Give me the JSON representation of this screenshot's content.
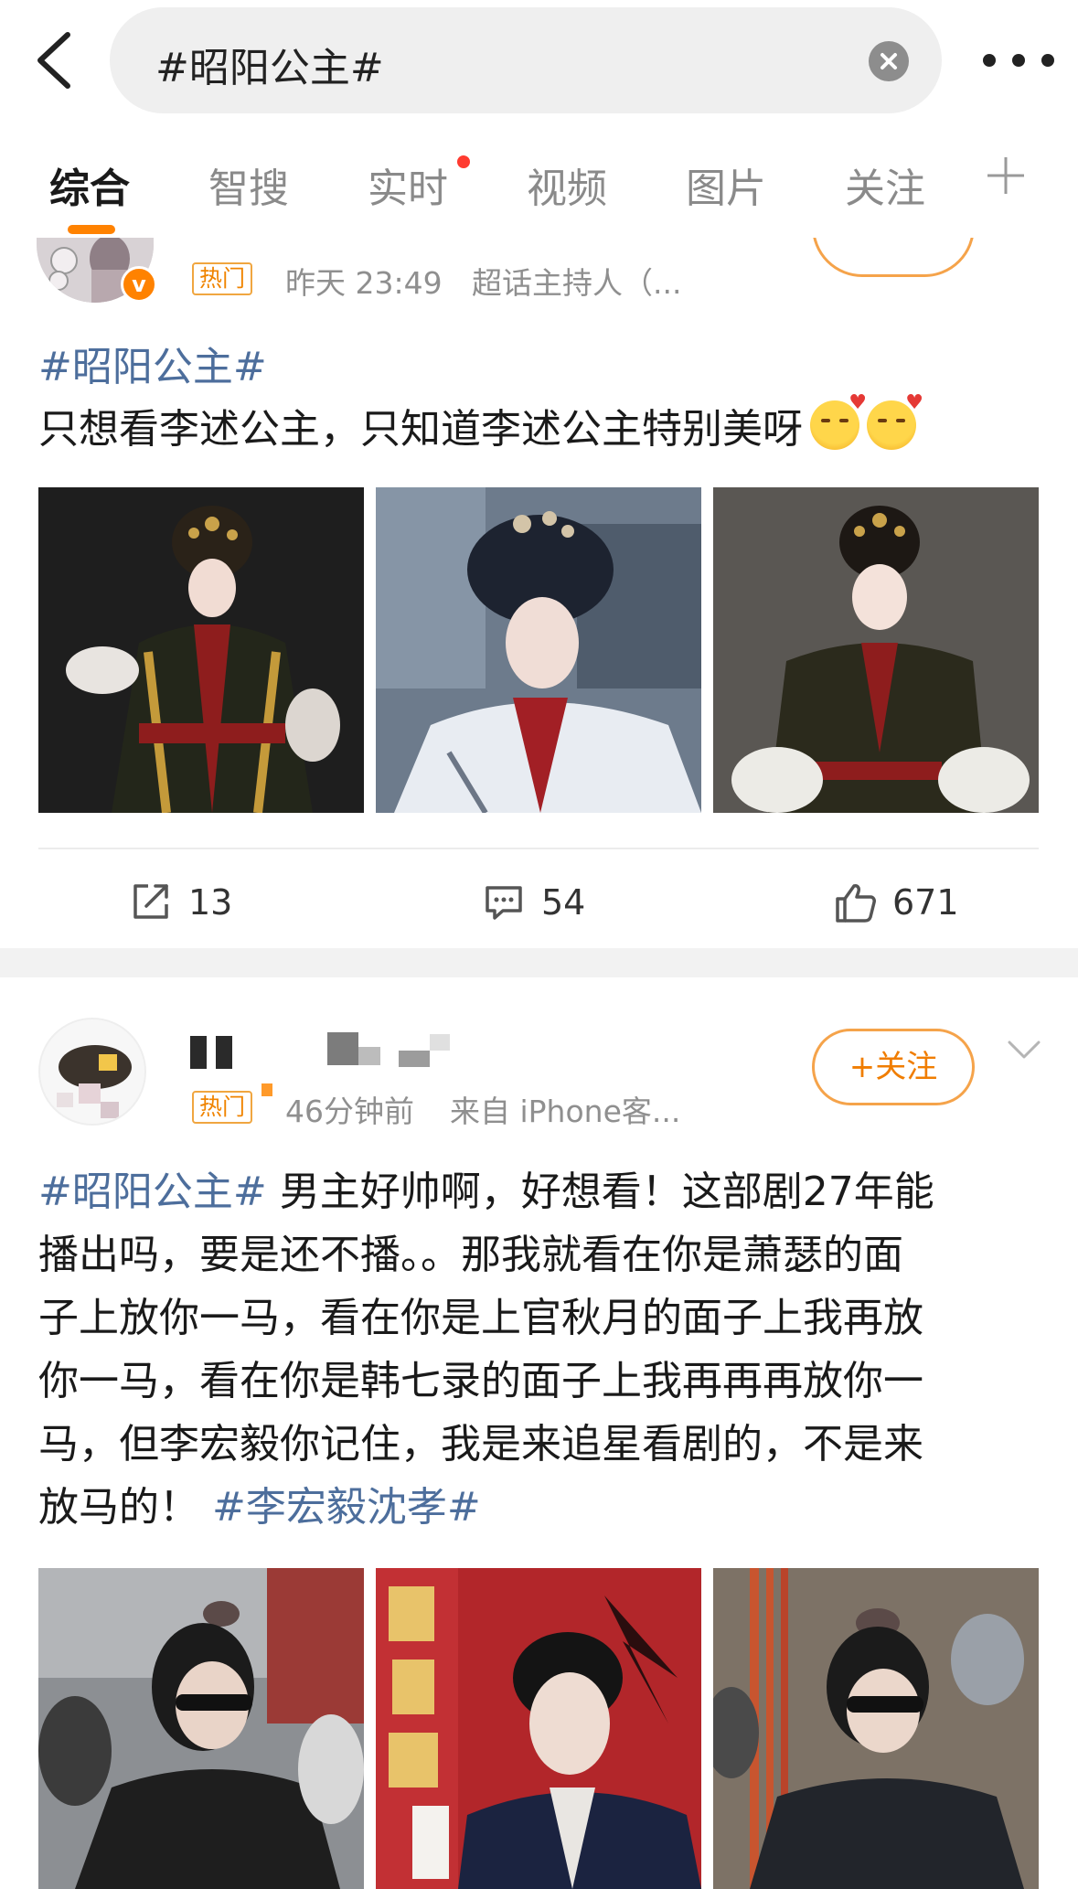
{
  "search": {
    "query": "#昭阳公主#"
  },
  "tabs": [
    {
      "label": "综合",
      "active": true
    },
    {
      "label": "智搜",
      "active": false
    },
    {
      "label": "实时",
      "active": false,
      "has_dot": true
    },
    {
      "label": "视频",
      "active": false
    },
    {
      "label": "图片",
      "active": false
    },
    {
      "label": "关注",
      "active": false
    }
  ],
  "post1": {
    "hot_badge": "热门",
    "time": "昨天 23:49",
    "role": "超话主持人（...",
    "hashtag": "#昭阳公主#",
    "text": "只想看李述公主，只知道李述公主特别美呀",
    "emoji": [
      "smiling-face-with-hearts",
      "smiling-face-with-hearts"
    ],
    "repost_count": "13",
    "comment_count": "54",
    "like_count": "671"
  },
  "post2": {
    "hot_badge": "热门",
    "time": "46分钟前",
    "source": "来自 iPhone客...",
    "follow_label": "+关注",
    "lines": [
      {
        "tag": "#昭阳公主#",
        "text": " 男主好帅啊，好想看！这部剧27年能"
      },
      {
        "text": "播出吗，要是还不播。。那我就看在你是萧瑟的面"
      },
      {
        "text": "子上放你一马，看在你是上官秋月的面子上我再放"
      },
      {
        "text": "你一马，看在你是韩七录的面子上我再再再放你一"
      },
      {
        "text": "马，但李宏毅你记住，我是来追星看剧的，不是来"
      },
      {
        "text": "放马的！",
        "tag_after": " #李宏毅沈孝#"
      }
    ]
  },
  "colors": {
    "accent": "#ff8200",
    "link": "#4d6e9c",
    "muted": "#8f8f8f"
  }
}
